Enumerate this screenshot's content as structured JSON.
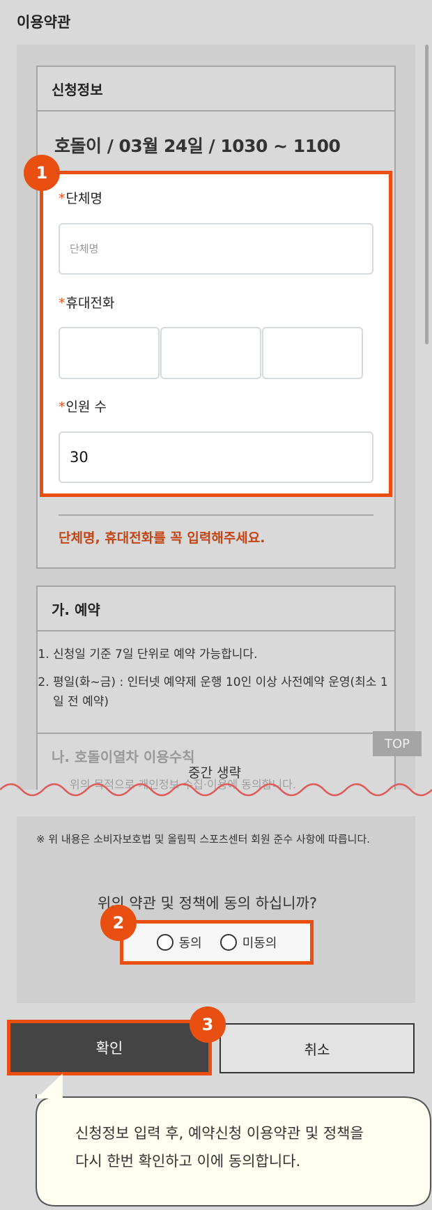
{
  "header": {
    "title": "이용약관"
  },
  "application": {
    "section_title": "신청정보",
    "selection": "호돌이 / 03월 24일 / 1030 ~ 1100",
    "required_mark": "*",
    "fields": {
      "group_name": {
        "label": "단체명",
        "placeholder": "단체명",
        "value": ""
      },
      "phone": {
        "label": "휴대전화",
        "values": [
          "",
          "",
          ""
        ]
      },
      "headcount": {
        "label": "인원 수",
        "value": "30"
      }
    },
    "notice": "단체명, 휴대전화를 꼭 입력해주세요."
  },
  "terms": {
    "reservation_title": "가. 예약",
    "reservation_items": [
      "신청일 기준 7일 단위로 예약 가능합니다.",
      "평일(화~금) : 인터넷 예약제 운행 10인 이상 사전예약 운영(최소 1일 전 예약)"
    ],
    "rules_title": "나. 호돌이열차 이용수칙",
    "rules_partial": "위의 목적으로 개인정보 수집·이용에 동의합니다.",
    "omitted_label": "중간 생략",
    "disclaimer": "※ 위 내용은 소비자보호법 및 올림픽 스포츠센터 회원 준수 사항에 따릅니다."
  },
  "agreement": {
    "question": "위의 약관 및 정책에 동의 하십니까?",
    "options": [
      "동의",
      "미동의"
    ]
  },
  "buttons": {
    "confirm": "확인",
    "cancel": "취소",
    "top": "TOP"
  },
  "callouts": [
    "1",
    "2",
    "3"
  ],
  "tooltip": {
    "line1": "신청정보 입력 후, 예약신청 이용약관 및 정책을",
    "line2": "다시 한번 확인하고 이에 동의합니다."
  },
  "colors": {
    "accent": "#ea4f12",
    "notice": "#c34516",
    "background": "#d9d9d9",
    "confirm_button": "#444444",
    "tooltip_bg": "#fffef0"
  }
}
